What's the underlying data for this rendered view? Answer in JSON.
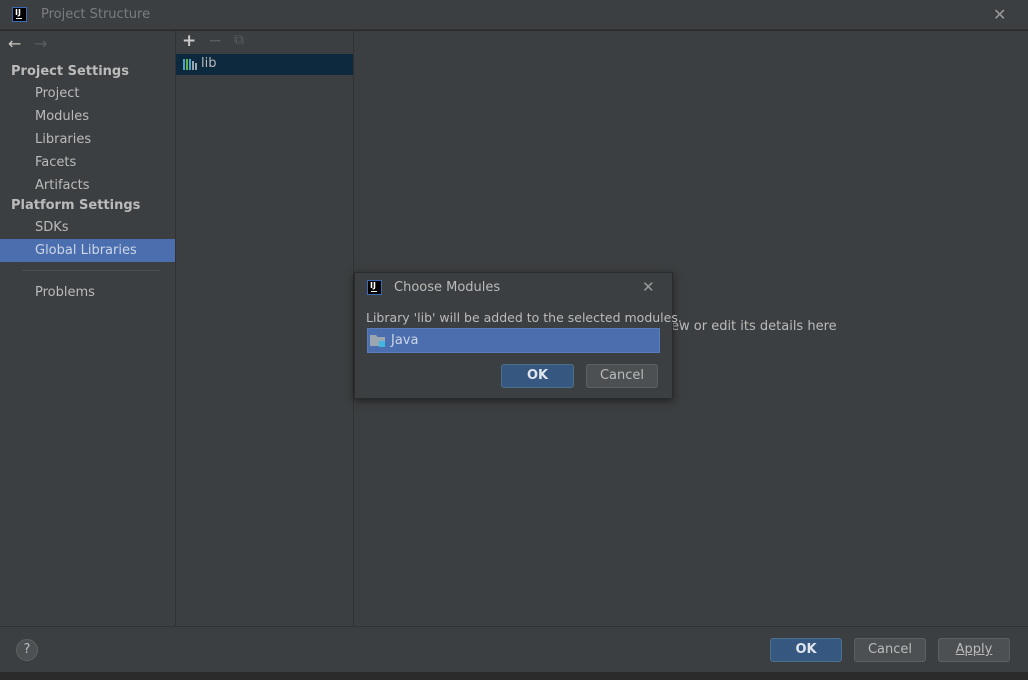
{
  "window": {
    "title": "Project Structure",
    "close": "✕"
  },
  "nav": {
    "back": "←",
    "forward": "→"
  },
  "sidebar": {
    "project_settings_header": "Project Settings",
    "project_items": [
      {
        "label": "Project"
      },
      {
        "label": "Modules"
      },
      {
        "label": "Libraries"
      },
      {
        "label": "Facets"
      },
      {
        "label": "Artifacts"
      }
    ],
    "platform_settings_header": "Platform Settings",
    "platform_items": [
      {
        "label": "SDKs"
      },
      {
        "label": "Global Libraries",
        "selected": true
      }
    ],
    "problems": "Problems"
  },
  "middle": {
    "toolbar": {
      "add": "+",
      "remove": "−",
      "copy": "⧉"
    },
    "items": [
      {
        "label": "lib",
        "selected": true
      }
    ]
  },
  "right": {
    "hint_visible": "ew or edit its details here"
  },
  "dialog": {
    "title": "Choose Modules",
    "close": "✕",
    "message": "Library 'lib' will be added to the selected modules.",
    "modules": [
      {
        "label": "Java",
        "selected": true
      }
    ],
    "ok": "OK",
    "cancel": "Cancel"
  },
  "footer": {
    "help": "?",
    "ok": "OK",
    "cancel": "Cancel",
    "apply": "Apply"
  },
  "colors": {
    "accent": "#4b6eaf",
    "default_button": "#365880",
    "background": "#3c3f41"
  }
}
